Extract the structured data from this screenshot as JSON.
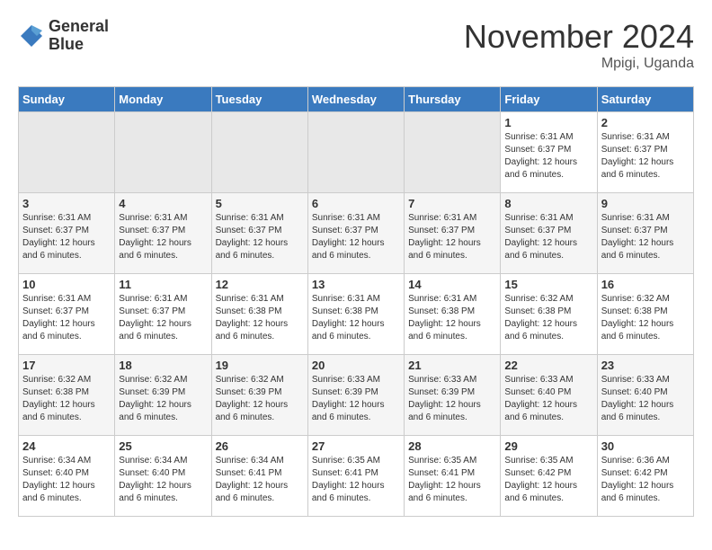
{
  "header": {
    "logo_line1": "General",
    "logo_line2": "Blue",
    "month_title": "November 2024",
    "location": "Mpigi, Uganda"
  },
  "days_of_week": [
    "Sunday",
    "Monday",
    "Tuesday",
    "Wednesday",
    "Thursday",
    "Friday",
    "Saturday"
  ],
  "weeks": [
    [
      {
        "num": "",
        "info": ""
      },
      {
        "num": "",
        "info": ""
      },
      {
        "num": "",
        "info": ""
      },
      {
        "num": "",
        "info": ""
      },
      {
        "num": "",
        "info": ""
      },
      {
        "num": "1",
        "info": "Sunrise: 6:31 AM\nSunset: 6:37 PM\nDaylight: 12 hours and 6 minutes."
      },
      {
        "num": "2",
        "info": "Sunrise: 6:31 AM\nSunset: 6:37 PM\nDaylight: 12 hours and 6 minutes."
      }
    ],
    [
      {
        "num": "3",
        "info": "Sunrise: 6:31 AM\nSunset: 6:37 PM\nDaylight: 12 hours and 6 minutes."
      },
      {
        "num": "4",
        "info": "Sunrise: 6:31 AM\nSunset: 6:37 PM\nDaylight: 12 hours and 6 minutes."
      },
      {
        "num": "5",
        "info": "Sunrise: 6:31 AM\nSunset: 6:37 PM\nDaylight: 12 hours and 6 minutes."
      },
      {
        "num": "6",
        "info": "Sunrise: 6:31 AM\nSunset: 6:37 PM\nDaylight: 12 hours and 6 minutes."
      },
      {
        "num": "7",
        "info": "Sunrise: 6:31 AM\nSunset: 6:37 PM\nDaylight: 12 hours and 6 minutes."
      },
      {
        "num": "8",
        "info": "Sunrise: 6:31 AM\nSunset: 6:37 PM\nDaylight: 12 hours and 6 minutes."
      },
      {
        "num": "9",
        "info": "Sunrise: 6:31 AM\nSunset: 6:37 PM\nDaylight: 12 hours and 6 minutes."
      }
    ],
    [
      {
        "num": "10",
        "info": "Sunrise: 6:31 AM\nSunset: 6:37 PM\nDaylight: 12 hours and 6 minutes."
      },
      {
        "num": "11",
        "info": "Sunrise: 6:31 AM\nSunset: 6:37 PM\nDaylight: 12 hours and 6 minutes."
      },
      {
        "num": "12",
        "info": "Sunrise: 6:31 AM\nSunset: 6:38 PM\nDaylight: 12 hours and 6 minutes."
      },
      {
        "num": "13",
        "info": "Sunrise: 6:31 AM\nSunset: 6:38 PM\nDaylight: 12 hours and 6 minutes."
      },
      {
        "num": "14",
        "info": "Sunrise: 6:31 AM\nSunset: 6:38 PM\nDaylight: 12 hours and 6 minutes."
      },
      {
        "num": "15",
        "info": "Sunrise: 6:32 AM\nSunset: 6:38 PM\nDaylight: 12 hours and 6 minutes."
      },
      {
        "num": "16",
        "info": "Sunrise: 6:32 AM\nSunset: 6:38 PM\nDaylight: 12 hours and 6 minutes."
      }
    ],
    [
      {
        "num": "17",
        "info": "Sunrise: 6:32 AM\nSunset: 6:38 PM\nDaylight: 12 hours and 6 minutes."
      },
      {
        "num": "18",
        "info": "Sunrise: 6:32 AM\nSunset: 6:39 PM\nDaylight: 12 hours and 6 minutes."
      },
      {
        "num": "19",
        "info": "Sunrise: 6:32 AM\nSunset: 6:39 PM\nDaylight: 12 hours and 6 minutes."
      },
      {
        "num": "20",
        "info": "Sunrise: 6:33 AM\nSunset: 6:39 PM\nDaylight: 12 hours and 6 minutes."
      },
      {
        "num": "21",
        "info": "Sunrise: 6:33 AM\nSunset: 6:39 PM\nDaylight: 12 hours and 6 minutes."
      },
      {
        "num": "22",
        "info": "Sunrise: 6:33 AM\nSunset: 6:40 PM\nDaylight: 12 hours and 6 minutes."
      },
      {
        "num": "23",
        "info": "Sunrise: 6:33 AM\nSunset: 6:40 PM\nDaylight: 12 hours and 6 minutes."
      }
    ],
    [
      {
        "num": "24",
        "info": "Sunrise: 6:34 AM\nSunset: 6:40 PM\nDaylight: 12 hours and 6 minutes."
      },
      {
        "num": "25",
        "info": "Sunrise: 6:34 AM\nSunset: 6:40 PM\nDaylight: 12 hours and 6 minutes."
      },
      {
        "num": "26",
        "info": "Sunrise: 6:34 AM\nSunset: 6:41 PM\nDaylight: 12 hours and 6 minutes."
      },
      {
        "num": "27",
        "info": "Sunrise: 6:35 AM\nSunset: 6:41 PM\nDaylight: 12 hours and 6 minutes."
      },
      {
        "num": "28",
        "info": "Sunrise: 6:35 AM\nSunset: 6:41 PM\nDaylight: 12 hours and 6 minutes."
      },
      {
        "num": "29",
        "info": "Sunrise: 6:35 AM\nSunset: 6:42 PM\nDaylight: 12 hours and 6 minutes."
      },
      {
        "num": "30",
        "info": "Sunrise: 6:36 AM\nSunset: 6:42 PM\nDaylight: 12 hours and 6 minutes."
      }
    ]
  ]
}
